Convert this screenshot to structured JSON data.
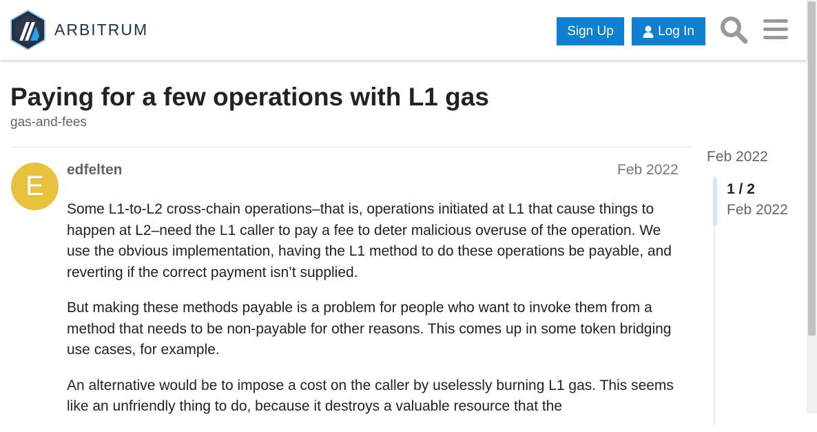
{
  "header": {
    "logo_text": "ARBITRUM",
    "signup_label": "Sign Up",
    "login_label": "Log In",
    "search_icon": "search-icon",
    "menu_icon": "hamburger-menu-icon"
  },
  "topic": {
    "title": "Paying for a few operations with L1 gas",
    "category": "gas-and-fees"
  },
  "post": {
    "avatar_letter": "E",
    "avatar_color": "#e8c13e",
    "username": "edfelten",
    "date": "Feb 2022",
    "paragraphs": [
      "Some L1-to-L2 cross-chain operations–that is, operations initiated at L1 that cause things to happen at L2–need the L1 caller to pay a fee to deter malicious overuse of the operation. We use the obvious implementation, having the L1 method to do these operations be payable, and reverting if the correct payment isn’t supplied.",
      "But making these methods payable is a problem for people who want to invoke them from a method that needs to be non-payable for other reasons. This comes up in some token bridging use cases, for example.",
      "An alternative would be to impose a cost on the caller by uselessly burning L1 gas. This seems like an unfriendly thing to do, because it destroys a valuable resource that the"
    ]
  },
  "timeline": {
    "start_date": "Feb 2022",
    "position": "1 / 2",
    "current_date": "Feb 2022"
  },
  "colors": {
    "accent": "#0f7fcf",
    "text": "#222222",
    "muted": "#646464"
  }
}
